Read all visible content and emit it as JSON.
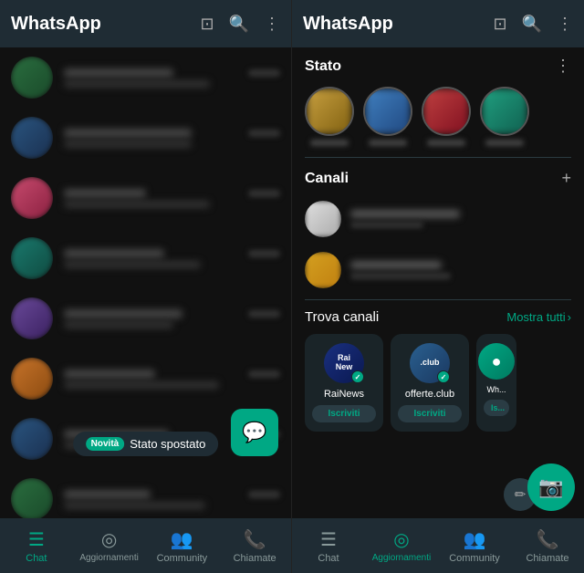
{
  "left": {
    "header": {
      "title": "WhatsApp"
    },
    "chats": [
      {
        "id": 1,
        "avatarClass": "green"
      },
      {
        "id": 2,
        "avatarClass": "blue"
      },
      {
        "id": 3,
        "avatarClass": "pink"
      },
      {
        "id": 4,
        "avatarClass": "teal"
      },
      {
        "id": 5,
        "avatarClass": "purple"
      },
      {
        "id": 6,
        "avatarClass": "orange"
      },
      {
        "id": 7,
        "avatarClass": "blue"
      },
      {
        "id": 8,
        "avatarClass": "green"
      }
    ],
    "status_notification": {
      "badge": "Novità",
      "text": "Stato spostato"
    },
    "nav": {
      "items": [
        {
          "label": "Chat",
          "icon": "💬",
          "active": true
        },
        {
          "label": "Aggiornamenti",
          "icon": "⊙",
          "active": false
        },
        {
          "label": "Community",
          "icon": "👥",
          "active": false
        },
        {
          "label": "Chiamate",
          "icon": "📞",
          "active": false
        }
      ]
    }
  },
  "right": {
    "header": {
      "title": "WhatsApp"
    },
    "stato": {
      "title": "Stato",
      "items": [
        {
          "avatarClass": "gold"
        },
        {
          "avatarClass": "blue2"
        },
        {
          "avatarClass": "red"
        },
        {
          "avatarClass": "teal2"
        }
      ]
    },
    "canali": {
      "title": "Canali",
      "add_icon": "+",
      "items": [
        {
          "avatarClass": "light"
        },
        {
          "avatarClass": "yellow"
        }
      ]
    },
    "trova": {
      "title": "Trova canali",
      "mostra_tutti": "Mostra tutti",
      "chevron": "›",
      "cards": [
        {
          "name": "RaiNews",
          "logo_text": "Rai\nNew",
          "logo_class": "rai",
          "verified": true,
          "subscribe_label": "Iscriviti"
        },
        {
          "name": "offerte.club",
          "logo_text": ".club",
          "logo_class": "club",
          "verified": true,
          "subscribe_label": "Iscriviti"
        },
        {
          "name": "Wh...",
          "logo_text": "",
          "logo_class": "whatsapp-card",
          "verified": false,
          "subscribe_label": "Is..."
        }
      ]
    },
    "nav": {
      "items": [
        {
          "label": "Chat",
          "icon": "💬",
          "active": false
        },
        {
          "label": "Aggiornamenti",
          "icon": "⊙",
          "active": true
        },
        {
          "label": "Community",
          "icon": "👥",
          "active": false
        },
        {
          "label": "Chiamate",
          "icon": "📞",
          "active": false
        }
      ]
    }
  }
}
